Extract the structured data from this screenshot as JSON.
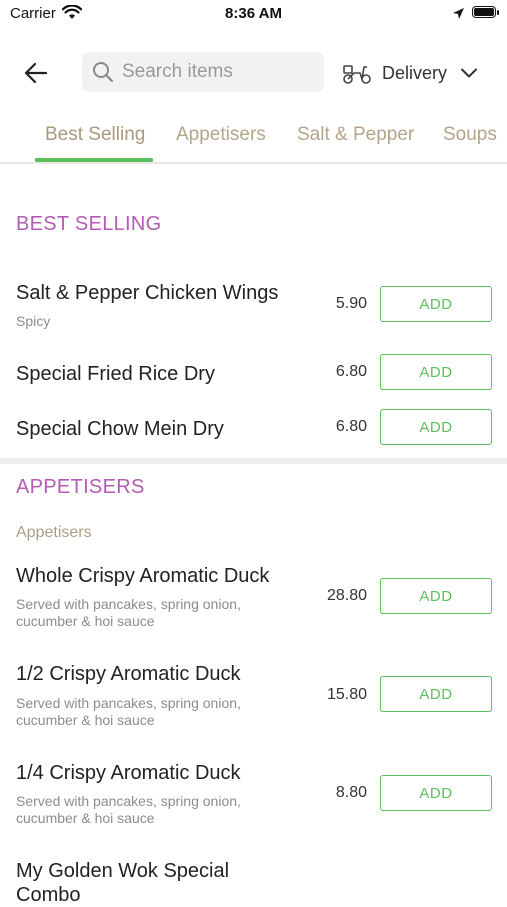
{
  "status_bar": {
    "carrier": "Carrier",
    "time": "8:36 AM"
  },
  "header": {
    "search_placeholder": "Search items",
    "delivery_label": "Delivery"
  },
  "tabs": [
    {
      "label": "Best Selling",
      "active": true
    },
    {
      "label": "Appetisers",
      "active": false
    },
    {
      "label": "Salt & Pepper",
      "active": false
    },
    {
      "label": "Soups",
      "active": false
    }
  ],
  "colors": {
    "accent_green": "#5cc05c",
    "section_purple": "#b45bb5",
    "tab_text": "#b3a58a"
  },
  "sections": [
    {
      "title": "BEST SELLING",
      "items": [
        {
          "name": "Salt & Pepper Chicken Wings",
          "desc": "Spicy",
          "price": "5.90",
          "button": "ADD"
        },
        {
          "name": "Special Fried Rice Dry",
          "price": "6.80",
          "button": "ADD"
        },
        {
          "name": "Special Chow Mein Dry",
          "price": "6.80",
          "button": "ADD"
        }
      ]
    },
    {
      "title": "APPETISERS",
      "subtitle": "Appetisers",
      "items": [
        {
          "name": "Whole Crispy Aromatic Duck",
          "desc_line1": "Served with pancakes, spring onion,",
          "desc_line2": "cucumber & hoi sauce",
          "price": "28.80",
          "button": "ADD"
        },
        {
          "name": "1/2 Crispy Aromatic Duck",
          "desc_line1": "Served with pancakes, spring onion,",
          "desc_line2": "cucumber & hoi sauce",
          "price": "15.80",
          "button": "ADD"
        },
        {
          "name": "1/4 Crispy Aromatic Duck",
          "desc_line1": "Served with pancakes, spring onion,",
          "desc_line2": "cucumber & hoi sauce",
          "price": "8.80",
          "button": "ADD"
        },
        {
          "name_line1": "My Golden Wok Special",
          "name_line2": "Combo"
        }
      ]
    }
  ]
}
